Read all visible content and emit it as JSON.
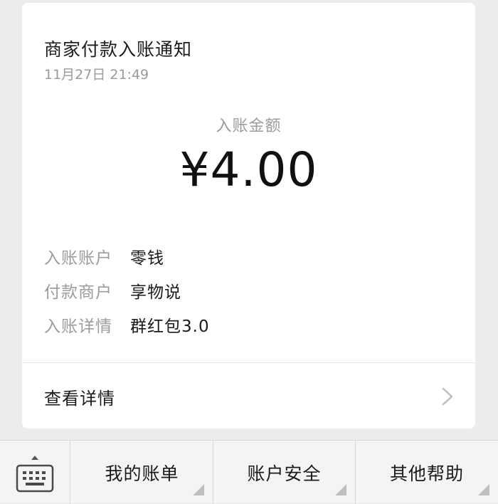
{
  "card": {
    "title": "商家付款入账通知",
    "time": "11月27日 21:49",
    "amount_label": "入账金额",
    "amount": "¥4.00",
    "rows": [
      {
        "key": "入账账户",
        "value": "零钱"
      },
      {
        "key": "付款商户",
        "value": "享物说"
      },
      {
        "key": "入账详情",
        "value": "群红包3.0"
      }
    ],
    "details_label": "查看详情"
  },
  "bottom_bar": {
    "keyboard_icon": "keyboard-icon",
    "menu": [
      "我的账单",
      "账户安全",
      "其他帮助"
    ]
  }
}
